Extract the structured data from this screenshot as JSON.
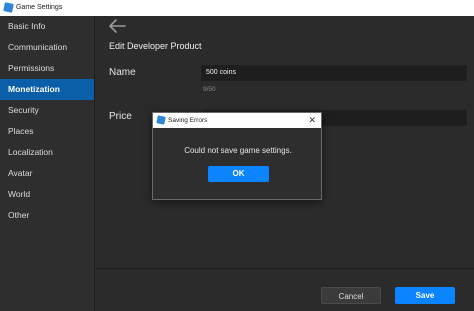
{
  "window": {
    "title": "Game Settings"
  },
  "sidebar": {
    "items": [
      {
        "label": "Basic Info"
      },
      {
        "label": "Communication"
      },
      {
        "label": "Permissions"
      },
      {
        "label": "Monetization",
        "active": true
      },
      {
        "label": "Security"
      },
      {
        "label": "Places"
      },
      {
        "label": "Localization"
      },
      {
        "label": "Avatar"
      },
      {
        "label": "World"
      },
      {
        "label": "Other"
      }
    ]
  },
  "main": {
    "heading": "Edit Developer Product",
    "name_label": "Name",
    "name_value": "500 coins",
    "name_counter": "9/50",
    "price_label": "Price"
  },
  "footer": {
    "cancel_label": "Cancel",
    "save_label": "Save"
  },
  "dialog": {
    "title": "Saving Errors",
    "message": "Could not save game settings.",
    "ok_label": "OK",
    "close_glyph": "✕"
  },
  "colors": {
    "accent": "#0a84ff",
    "sidebar_active": "#0b5fa8",
    "background": "#2b2b2b"
  },
  "icons": {
    "back": "back-arrow-icon",
    "app": "roblox-studio-icon"
  }
}
